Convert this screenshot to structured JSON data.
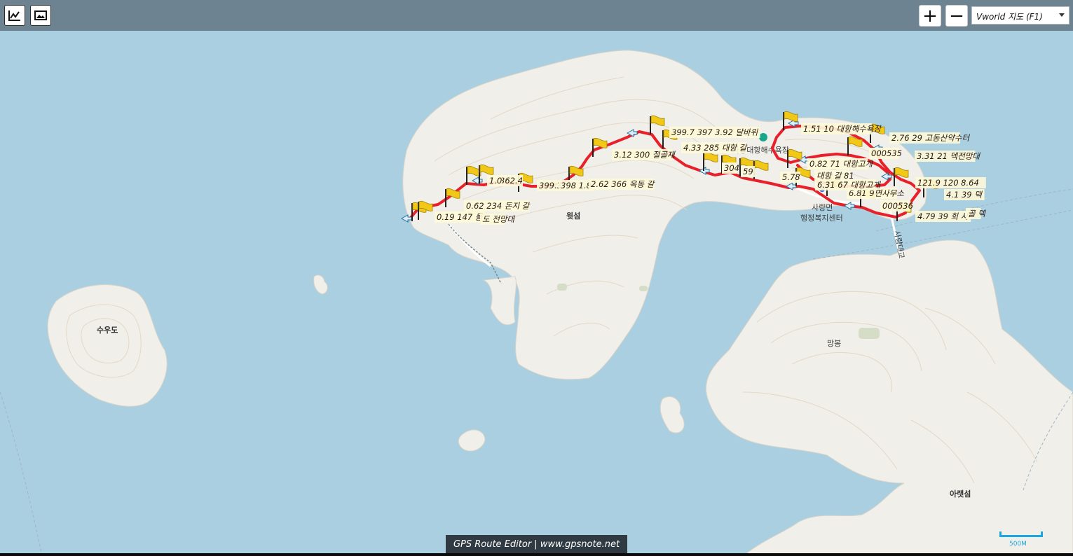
{
  "toolbar": {
    "chart_icon": "chart-line-icon",
    "image_icon": "image-icon",
    "zoom_in_label": "+",
    "zoom_out_label": "−",
    "map_type_selected": "Vworld 지도 (F1)"
  },
  "places": {
    "sudo": "수우도",
    "wotseom": "윗섬",
    "mangbong": "망봉",
    "araetseom": "아랫섬",
    "office_line1": "사량면",
    "office_line2": "행정복지센터",
    "beach": "사량대항해수욕장",
    "bridge": "사량대교",
    "peak_sign": "옥녀봉"
  },
  "waypoints": [
    "0.19 147 들",
    "도 전망대",
    "0.62 234 돈지 갈",
    "362.4",
    "1.0",
    "399.3",
    "398 1.8",
    "2.62 366 옥동 갈",
    "3.12 300 절골재",
    "399.7 397 3.92 달바위",
    "4.33 285 대항 갈",
    "1.51 10 대항해수욕장",
    "0.82 71 대항고개",
    "2.76 29 고동산약수터",
    "3.31 21 덱전망대",
    "121.9 120 8.64",
    "4.1 39 덱",
    "4.79 39 회 사",
    "골 덱",
    "6.81 9면사무소",
    "5.78",
    "6.31 67 대항고개",
    "000536",
    "000535",
    "59",
    "대항 갈 81",
    "304"
  ],
  "footer": {
    "text": "GPS Route Editor | www.gpsnote.net"
  },
  "scale": {
    "label": "500M"
  },
  "colors": {
    "sea": "#a9cfe0",
    "land": "#f1efe9",
    "contour": "#e2d7c8",
    "route": "#e8202a",
    "topbar": "#6d8391",
    "flag": "#f2c818"
  }
}
